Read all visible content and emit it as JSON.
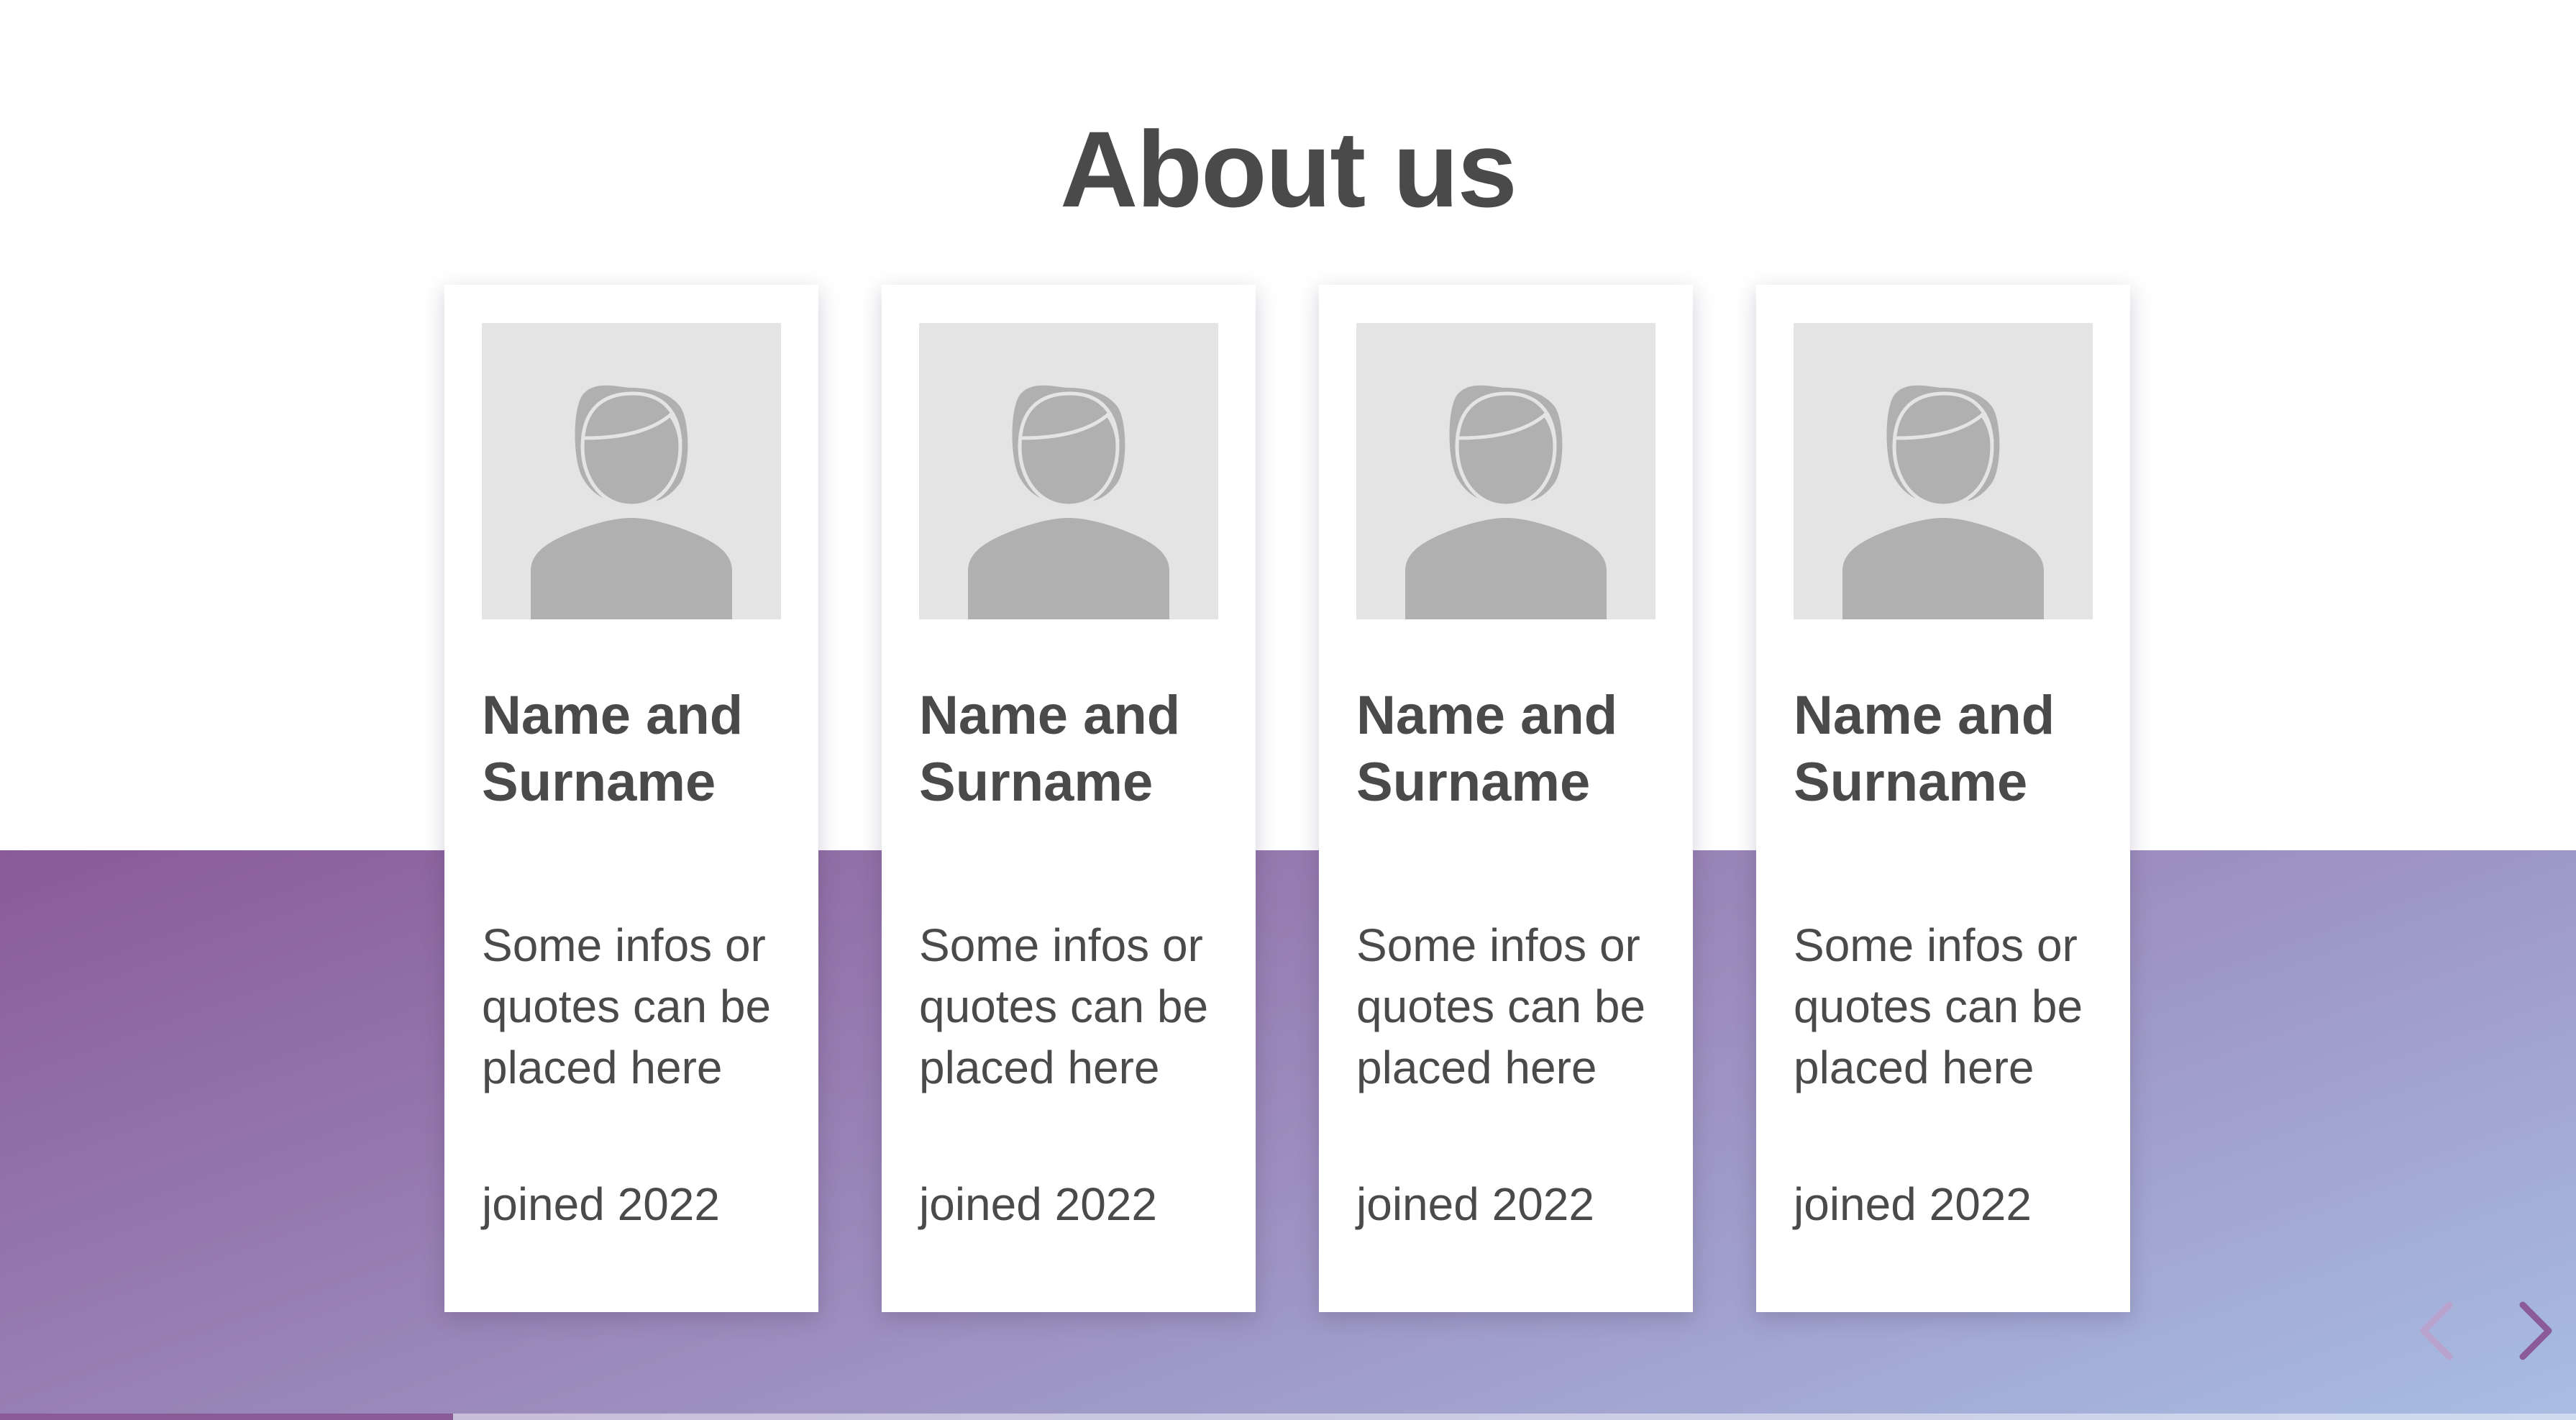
{
  "page": {
    "title": "About us"
  },
  "team": [
    {
      "name": "Name and Surname",
      "info": "Some infos or quotes can be placed here",
      "joined": "joined 2022",
      "photo_icon": "female-avatar-placeholder-icon"
    },
    {
      "name": "Name and Surname",
      "info": "Some infos or quotes can be placed here",
      "joined": "joined 2022",
      "photo_icon": "female-avatar-placeholder-icon"
    },
    {
      "name": "Name and Surname",
      "info": "Some infos or quotes can be placed here",
      "joined": "joined 2022",
      "photo_icon": "female-avatar-placeholder-icon"
    },
    {
      "name": "Name and Surname",
      "info": "Some infos or quotes can be placed here",
      "joined": "joined 2022",
      "photo_icon": "female-avatar-placeholder-icon"
    }
  ],
  "navigation": {
    "prev_icon": "chevron-left-icon",
    "next_icon": "chevron-right-icon",
    "progress_fraction": 0.176
  },
  "colors": {
    "band_start": "#8a5b97",
    "band_mid": "#9a87b9",
    "band_end": "#a8bde3",
    "text": "#4a4a4a",
    "photo_bg": "#e4e4e4",
    "avatar": "#b0b0b0",
    "accent": "#8a5b97"
  }
}
